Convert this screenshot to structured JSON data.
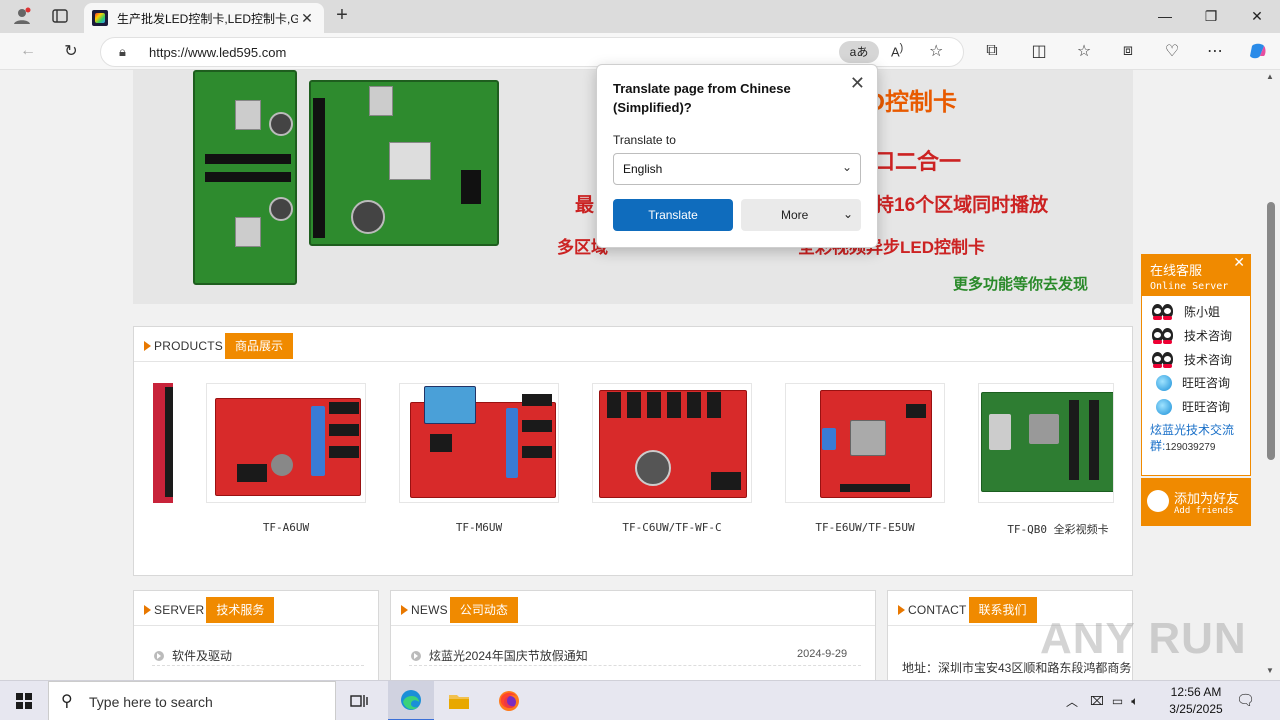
{
  "browser": {
    "tab_title": "生产批发LED控制卡,LED控制卡,G",
    "url": "https://www.led595.com",
    "translate_icon": "aあ"
  },
  "banner": {
    "line1": "彩LED控制卡",
    "line2": "口二合一",
    "line3a": "最",
    "line3b": "持16个区域同时播放",
    "line4": "多区域",
    "line4_tail": "全彩视频异步LED控制卡",
    "line5": "更多功能等你去发现"
  },
  "products": {
    "en": "PRODUCTS",
    "cn": "商品展示",
    "items": [
      {
        "name": "TF-A6UW"
      },
      {
        "name": "TF-M6UW"
      },
      {
        "name": "TF-C6UW/TF-WF-C"
      },
      {
        "name": "TF-E6UW/TF-E5UW"
      },
      {
        "name": "TF-QB0 全彩视频卡"
      }
    ]
  },
  "server": {
    "en": "SERVER",
    "cn": "技术服务",
    "items": [
      "软件及驱动"
    ]
  },
  "news": {
    "en": "NEWS",
    "cn": "公司动态",
    "items": [
      {
        "title": "炫蓝光2024年国庆节放假通知",
        "date": "2024-9-29"
      }
    ]
  },
  "contact": {
    "en": "CONTACT",
    "cn": "联系我们",
    "address": "地址：深圳市宝安43区顺和路东段鸿都商务"
  },
  "service": {
    "title": "在线客服",
    "subtitle": "Online Server",
    "qq": [
      "陈小姐",
      "技术咨询",
      "技术咨询"
    ],
    "wangwang": [
      "旺旺咨询",
      "旺旺咨询"
    ],
    "group_label": "炫蓝光技术交流群:",
    "group_number": "129039279",
    "add_cn": "添加为好友",
    "add_en": "Add friends"
  },
  "translate": {
    "title": "Translate page from Chinese (Simplified)?",
    "label": "Translate to",
    "language": "English",
    "translate_button": "Translate",
    "more_button": "More"
  },
  "watermark": "ANY RUN",
  "taskbar": {
    "search_placeholder": "Type here to search",
    "time": "12:56 AM",
    "date": "3/25/2025"
  }
}
